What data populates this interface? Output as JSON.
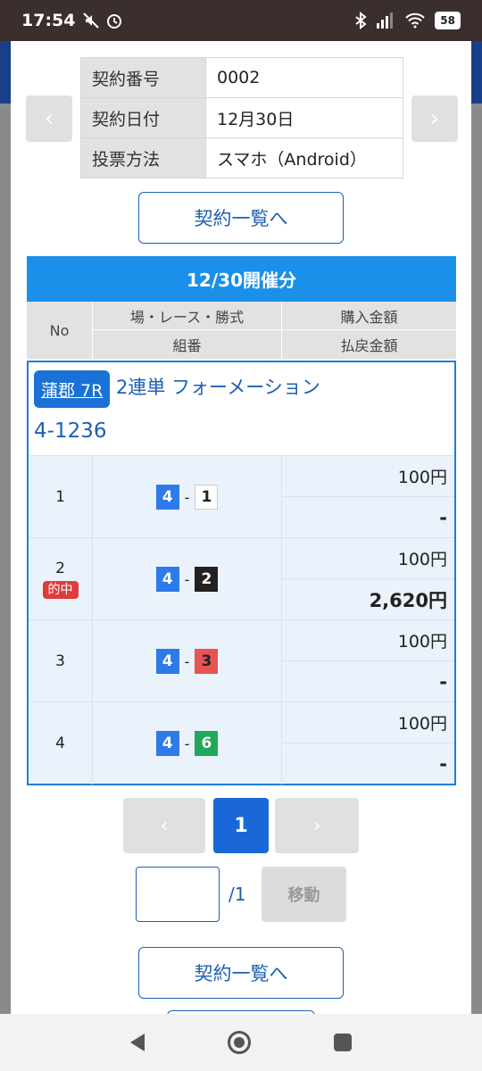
{
  "status_bar": {
    "time": "17:54",
    "battery": "58"
  },
  "contract_info": [
    {
      "key": "契約番号",
      "value": "0002"
    },
    {
      "key": "契約日付",
      "value": "12月30日"
    },
    {
      "key": "投票方法",
      "value": "スマホ（Android）"
    }
  ],
  "nav": {
    "prev_arrow": "‹",
    "next_arrow": "›"
  },
  "buttons": {
    "contract_list": "契約一覧へ",
    "contract_list_bottom": "契約一覧へ",
    "move": "移動"
  },
  "session_header": "12/30開催分",
  "table_header": {
    "no": "No",
    "venue_race_type": "場・レース・勝式",
    "purchase_amount": "購入金額",
    "combination": "組番",
    "payout_amount": "払戻金額"
  },
  "bet": {
    "venue": "蒲郡 7R",
    "type": "2連単 フォーメーション",
    "combo": "4-1236",
    "rows": [
      {
        "no": "1",
        "first": "4",
        "second": "1",
        "purchase": "100円",
        "payout": "-",
        "hit": ""
      },
      {
        "no": "2",
        "first": "4",
        "second": "2",
        "purchase": "100円",
        "payout": "2,620円",
        "hit": "的中"
      },
      {
        "no": "3",
        "first": "4",
        "second": "3",
        "purchase": "100円",
        "payout": "-",
        "hit": ""
      },
      {
        "no": "4",
        "first": "4",
        "second": "6",
        "purchase": "100円",
        "payout": "-",
        "hit": ""
      }
    ],
    "separator": "-"
  },
  "pagination": {
    "prev": "‹",
    "current": "1",
    "next": "›",
    "total": "/1"
  },
  "colors": {
    "accent": "#1a90e8",
    "primary": "#1a68d8",
    "hit": "#e03c3c"
  }
}
